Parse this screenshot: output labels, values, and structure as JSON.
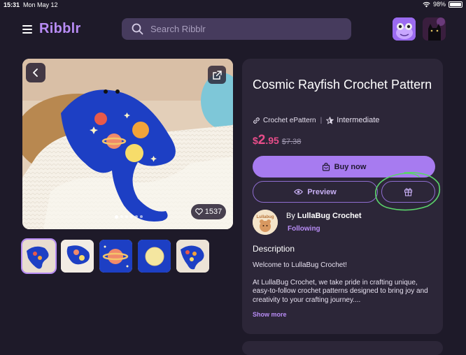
{
  "status_bar": {
    "time": "15:31",
    "date": "Mon May 12",
    "battery": "98%"
  },
  "header": {
    "logo": "Ribblr",
    "search_placeholder": "Search Ribblr"
  },
  "product": {
    "likes": "1537",
    "title": "Cosmic Rayfish Crochet Pattern",
    "type": "Crochet ePattern",
    "separator": "|",
    "level": "Intermediate",
    "price_currency": "$",
    "price_main": "2",
    "price_decimal": ".95",
    "price_old": "$7.38",
    "buy_label": "Buy now",
    "preview_label": "Preview"
  },
  "seller": {
    "by": "By ",
    "name": "LullaBug Crochet",
    "follow_label": "Following",
    "avatar_text": "Lullabug"
  },
  "description": {
    "heading": "Description",
    "para1": "Welcome to LullaBug Crochet!",
    "para2": "At LullaBug Crochet, we take pride in crafting unique, easy-to-follow crochet patterns designed to bring joy and creativity to your crafting journey....",
    "show_more": "Show more"
  },
  "gallery": {
    "thumbnail_count": 5,
    "active_index": 0,
    "dot_count": 6
  },
  "colors": {
    "accent": "#a77bf0",
    "price": "#e84d8a",
    "background": "#1e1a29",
    "panel": "#2c2638",
    "annotation": "#5bd46b"
  }
}
